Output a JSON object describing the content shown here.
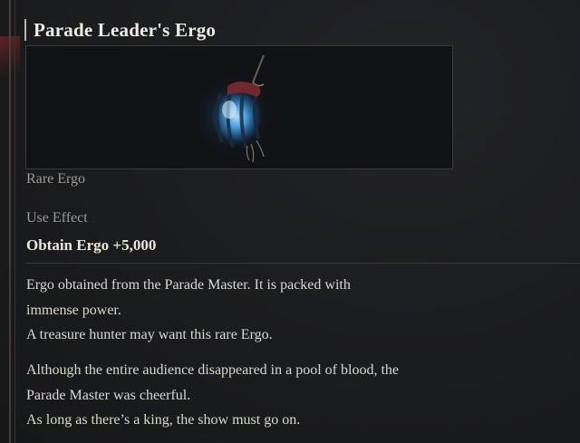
{
  "item": {
    "name": "Parade Leader's Ergo",
    "rarity": "Rare Ergo",
    "effect_label": "Use Effect",
    "effect_value": "Obtain Ergo +5,000",
    "description": {
      "paragraph1": [
        "Ergo obtained from the Parade Master. It is packed with",
        "immense power.",
        "A treasure hunter may want this rare Ergo."
      ],
      "paragraph2": [
        "Although the entire audience disappeared in a pool of blood, the",
        "Parade Master was cheerful.",
        "As long as there’s a king, the show must go on."
      ]
    },
    "icon": "ergo-orb-icon"
  },
  "colors": {
    "background": "#1b1c1e",
    "title": "#f0ece2",
    "secondary_text": "#9d9a92",
    "orb_glow": "#4fb3ff",
    "frame_accent_red": "#962828"
  }
}
